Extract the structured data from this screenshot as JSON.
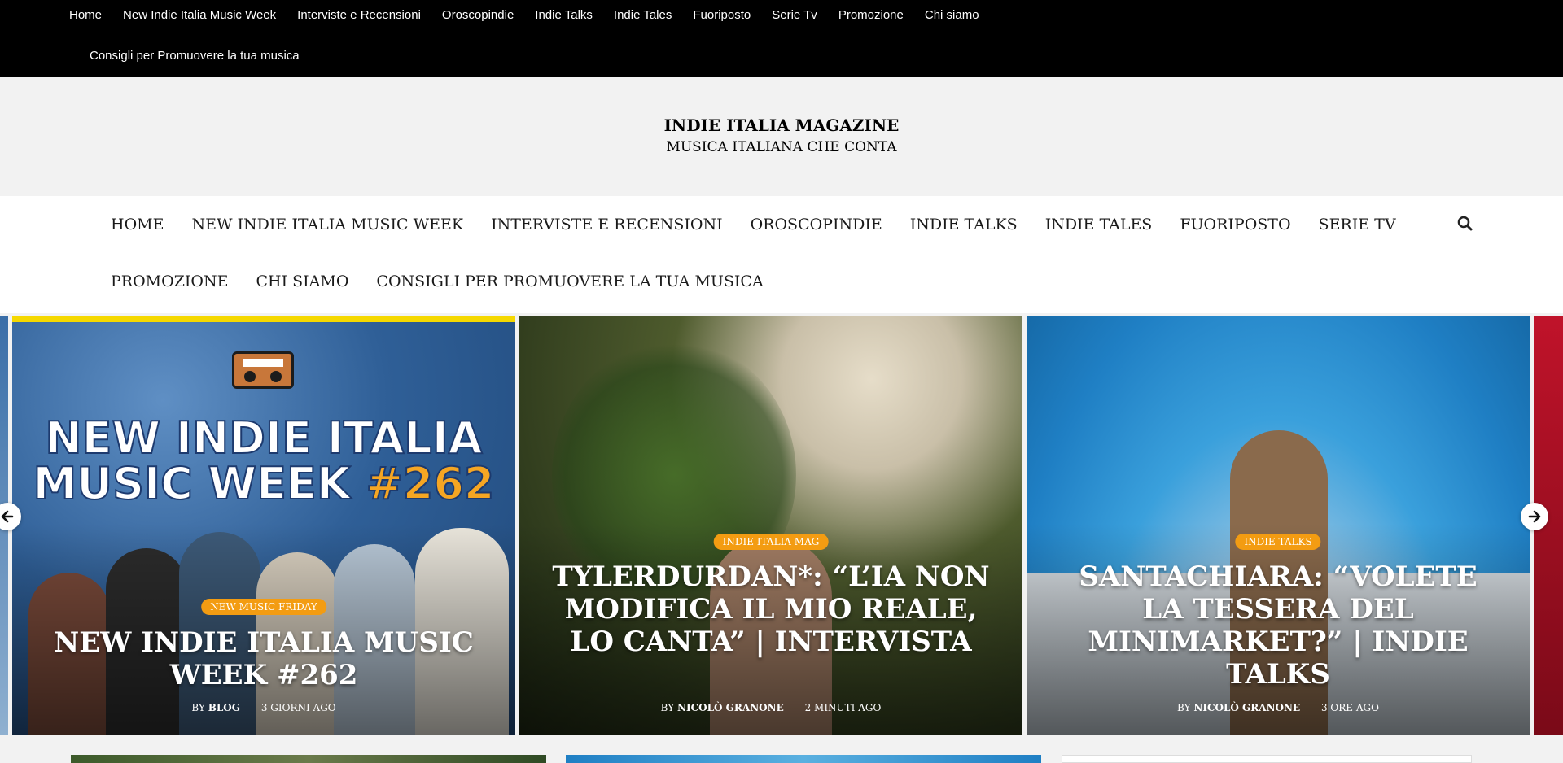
{
  "topbar": {
    "items": [
      "Home",
      "New Indie Italia Music Week",
      "Interviste e Recensioni",
      "Oroscopindie",
      "Indie Talks",
      "Indie Tales",
      "Fuoriposto",
      "Serie Tv",
      "Promozione",
      "Chi siamo"
    ],
    "items_row2": [
      "Consigli per Promuovere la tua musica"
    ]
  },
  "header": {
    "title": "INDIE ITALIA MAGAZINE",
    "tagline": "MUSICA ITALIANA CHE CONTA"
  },
  "mainnav": {
    "items": [
      "HOME",
      "NEW INDIE ITALIA MUSIC WEEK",
      "INTERVISTE E RECENSIONI",
      "OROSCOPINDIE",
      "INDIE TALKS",
      "INDIE TALES",
      "FUORIPOSTO",
      "SERIE TV"
    ],
    "items_row2": [
      "PROMOZIONE",
      "CHI SIAMO",
      "CONSIGLI PER PROMUOVERE LA TUA MUSICA"
    ],
    "search_icon": "search-icon"
  },
  "slides": [
    {
      "poster_line1": "NEW INDIE ITALIA",
      "poster_line2": "MUSIC WEEK",
      "poster_number": "#262",
      "category": "NEW MUSIC FRIDAY",
      "title": "NEW INDIE ITALIA MUSIC WEEK #262",
      "by": "BY",
      "author": "BLOG",
      "time": "3 GIORNI AGO"
    },
    {
      "category": "INDIE ITALIA MAG",
      "title": "TYLERDURDAN*: “L’IA NON MODIFICA IL MIO REALE, LO CANTA” | INTERVISTA",
      "by": "BY",
      "author": "NICOLÒ GRANONE",
      "time": "2 MINUTI AGO"
    },
    {
      "category": "INDIE TALKS",
      "title": "SANTACHIARA: “VOLETE LA TESSERA DEL MINIMARKET?” | INDIE TALKS",
      "by": "BY",
      "author": "NICOLÒ GRANONE",
      "time": "3 ORE AGO"
    }
  ],
  "colors": {
    "badge": "#f39c12",
    "topbar": "#000000",
    "accent_yellow": "#f5d800"
  }
}
